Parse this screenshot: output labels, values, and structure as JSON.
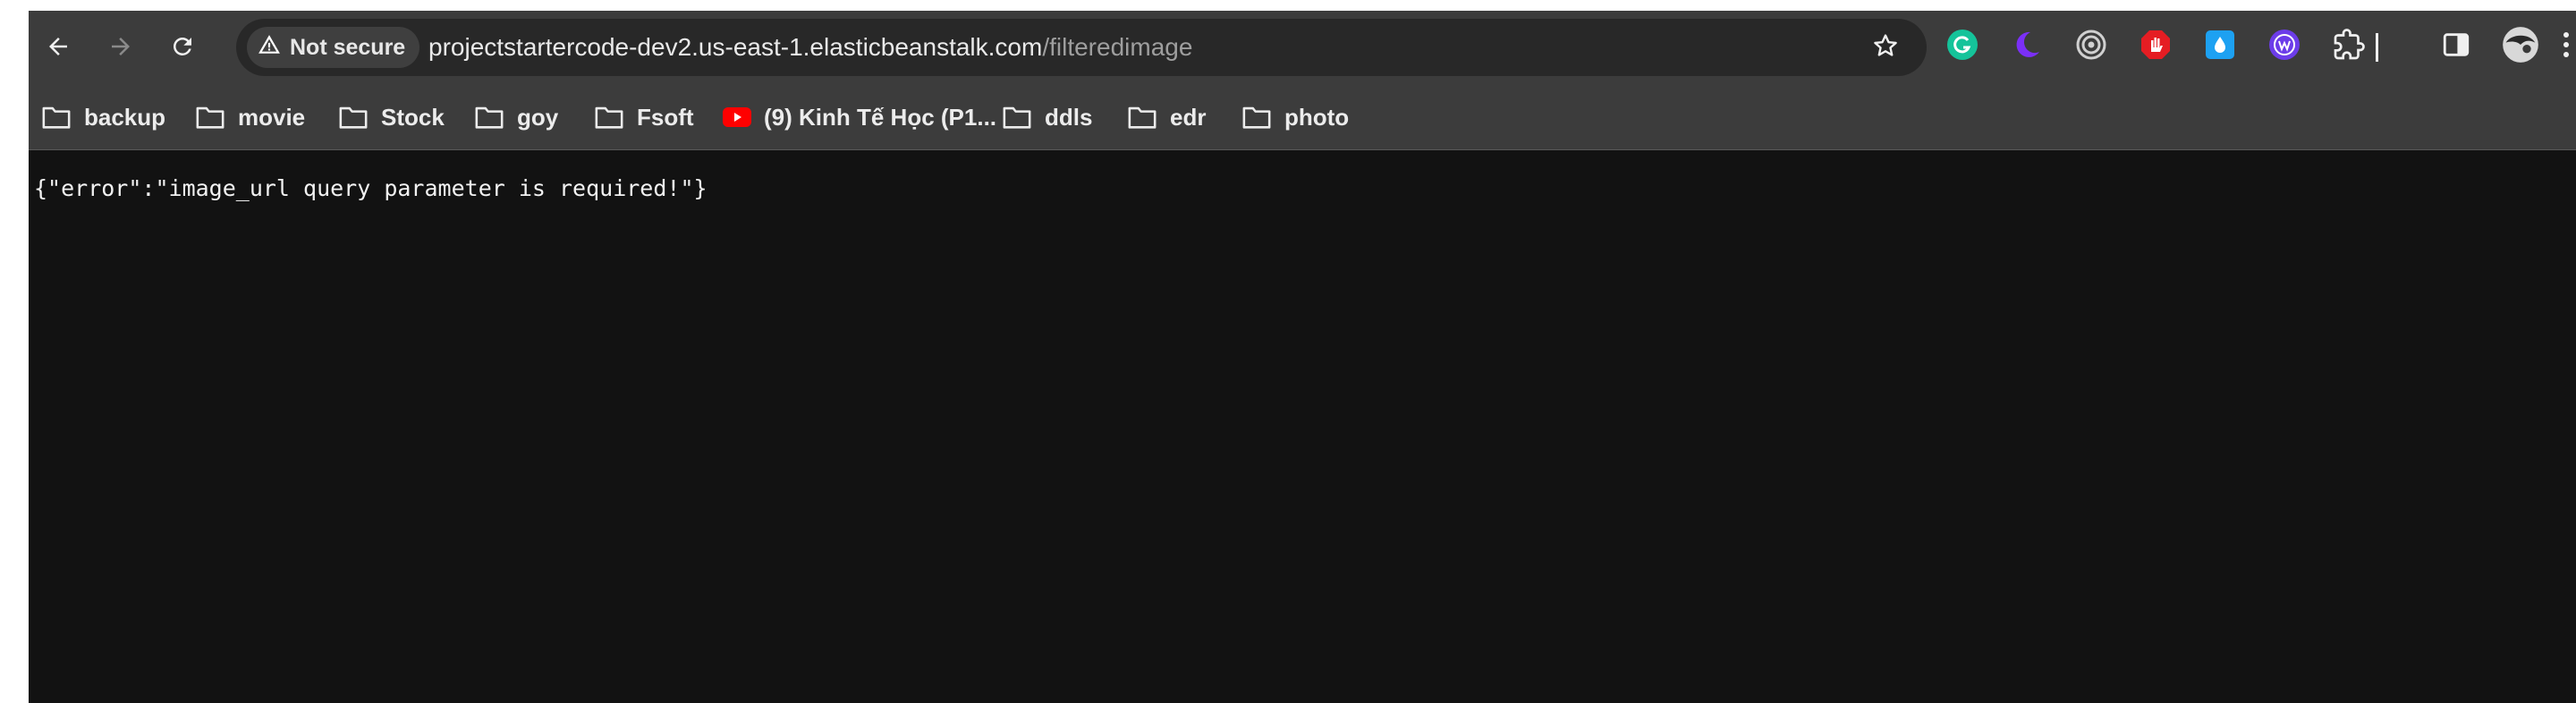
{
  "browser": {
    "security_label": "Not secure",
    "url_host": "projectstartercode-dev2.us-east-1.elasticbeanstalk.com",
    "url_path": "/filteredimage"
  },
  "nav": {
    "icons": [
      "back-arrow-icon",
      "forward-arrow-icon",
      "reload-icon"
    ]
  },
  "extensions": [
    {
      "icon": "grammarly-icon",
      "color": "#15c39a"
    },
    {
      "icon": "dark-mode-moon-icon",
      "color": "#7b2ff7"
    },
    {
      "icon": "target-icon",
      "color": "#d0d0d0"
    },
    {
      "icon": "adblock-hand-icon",
      "color": "#e51d23"
    },
    {
      "icon": "water-drop-icon",
      "color": "#1da1f2"
    },
    {
      "icon": "wappalyzer-icon",
      "color": "#6c3ce9"
    },
    {
      "icon": "extensions-puzzle-icon",
      "color": "#f0f0f0"
    },
    {
      "icon": "side-panel-icon",
      "color": "#f0f0f0"
    },
    {
      "icon": "profile-avatar-icon",
      "color": "#e0e0e0"
    }
  ],
  "bookmarks": [
    {
      "label": "backup",
      "icon": "folder-icon"
    },
    {
      "label": "movie",
      "icon": "folder-icon"
    },
    {
      "label": "Stock",
      "icon": "folder-icon"
    },
    {
      "label": "goy",
      "icon": "folder-icon"
    },
    {
      "label": "Fsoft",
      "icon": "folder-icon"
    },
    {
      "label": "(9) Kinh Tế Học (P1...",
      "icon": "youtube-icon"
    },
    {
      "label": "ddls",
      "icon": "folder-icon"
    },
    {
      "label": "edr",
      "icon": "folder-icon"
    },
    {
      "label": "photo",
      "icon": "folder-icon"
    }
  ],
  "page": {
    "body_text": "{\"error\":\"image_url query parameter is required!\"}"
  },
  "colors": {
    "toolbar_bg": "#3c3c3c",
    "omnibox_bg": "#282828",
    "page_bg": "#121212",
    "text": "#e9e9e9",
    "url_path": "#9e9e9e"
  }
}
